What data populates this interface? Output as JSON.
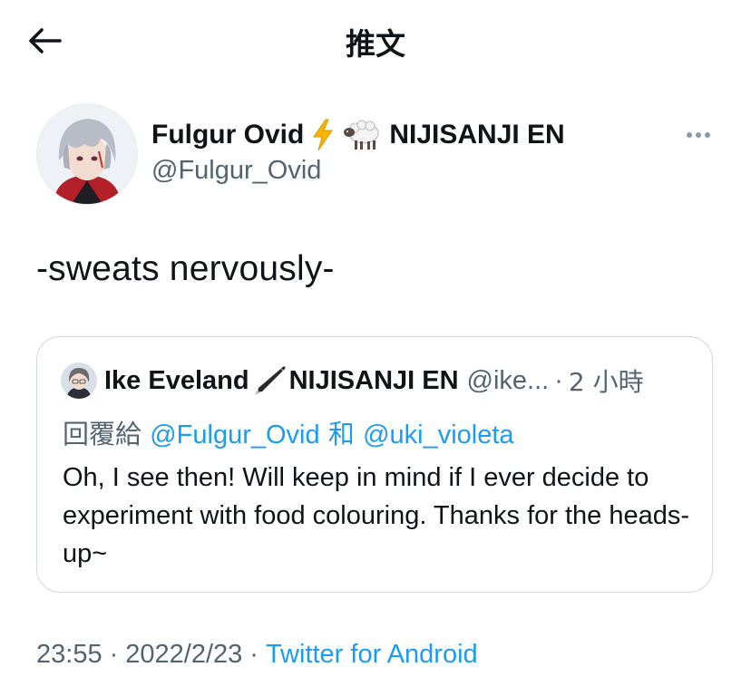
{
  "header": {
    "title": "推文"
  },
  "tweet": {
    "author_name": "Fulgur Ovid",
    "name_emojis": [
      "⚡",
      "🐑"
    ],
    "author_org": "NIJISANJI EN",
    "author_handle": "@Fulgur_Ovid",
    "text": "-sweats nervously-",
    "time": "23:55",
    "date": "2022/2/23",
    "source": "Twitter for Android",
    "separator": "·"
  },
  "quote": {
    "author_name": "Ike Eveland",
    "name_emoji": "🖋",
    "author_org": "NIJISANJI EN",
    "author_handle": "@ike...",
    "separator": "·",
    "time": "2 小時",
    "reply_prefix": "回覆給",
    "reply_mention_1": "@Fulgur_Ovid",
    "reply_and": "和",
    "reply_mention_2": "@uki_violeta",
    "text": "Oh, I see then! Will keep in mind if I ever decide to experiment with food colouring. Thanks for the heads-up~"
  },
  "icons": {
    "back": "arrow-left-icon",
    "more": "more-horizontal-icon"
  },
  "colors": {
    "link": "#1d9bf0",
    "secondary_text": "#536471",
    "border": "#cfd9de",
    "lightning": "#f4b400"
  }
}
